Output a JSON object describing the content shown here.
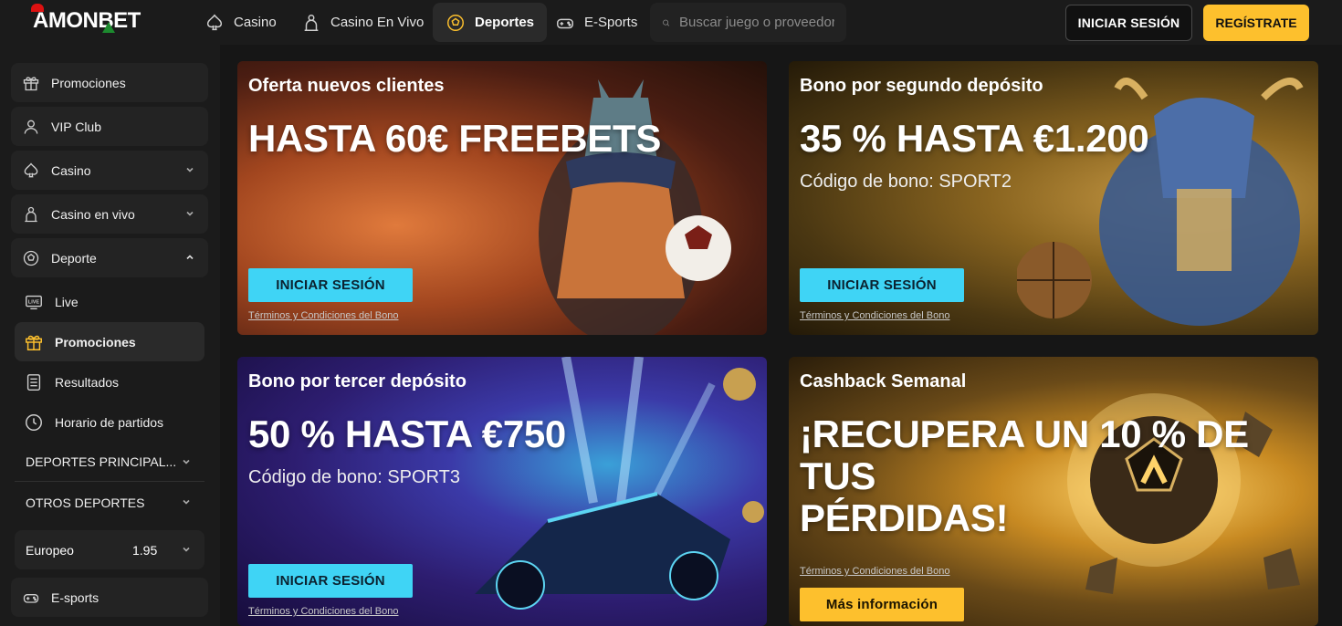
{
  "brand": {
    "logo_text": "AMONBET"
  },
  "topnav": {
    "items": [
      {
        "label": "Casino",
        "icon": "spade-icon"
      },
      {
        "label": "Casino En Vivo",
        "icon": "dealer-icon"
      },
      {
        "label": "Deportes",
        "icon": "soccer-ball-icon",
        "active": true
      },
      {
        "label": "E-Sports",
        "icon": "gamepad-icon"
      }
    ],
    "search_placeholder": "Buscar juego o proveedor",
    "login_label": "INICIAR SESIÓN",
    "register_label": "REGÍSTRATE"
  },
  "sidebar": {
    "items": [
      {
        "label": "Promociones",
        "icon": "gift-icon"
      },
      {
        "label": "VIP Club",
        "icon": "user-icon"
      },
      {
        "label": "Casino",
        "icon": "spade-icon"
      },
      {
        "label": "Casino en vivo",
        "icon": "dealer-icon"
      },
      {
        "label": "Deporte",
        "icon": "soccer-ball-icon"
      }
    ],
    "sub_items": [
      {
        "label": "Live",
        "icon": "live-icon"
      },
      {
        "label": "Promociones",
        "icon": "gift-icon",
        "active": true
      },
      {
        "label": "Resultados",
        "icon": "clipboard-icon"
      },
      {
        "label": "Horario de partidos",
        "icon": "clock-icon"
      }
    ],
    "categories": [
      "DEPORTES PRINCIPAL...",
      "OTROS DEPORTES"
    ],
    "odds_format": {
      "label": "Europeo",
      "value": "1.95"
    },
    "esports": {
      "label": "E-sports",
      "icon": "gamepad-icon"
    }
  },
  "promos": [
    {
      "kicker": "Oferta nuevos clientes",
      "headline": "HASTA 60€ FREEBETS",
      "code": "",
      "cta": "INICIAR SESIÓN",
      "terms": "Términos y Condiciones del Bono"
    },
    {
      "kicker": "Bono por segundo depósito",
      "headline": "35 % HASTA €1.200",
      "code": "Código de bono: SPORT2",
      "cta": "INICIAR SESIÓN",
      "terms": "Términos y Condiciones del Bono"
    },
    {
      "kicker": "Bono por tercer depósito",
      "headline": "50 % HASTA €750",
      "code": "Código de bono: SPORT3",
      "cta": "INICIAR SESIÓN",
      "terms": "Términos y Condiciones del Bono"
    },
    {
      "kicker": "Cashback Semanal",
      "headline_line1": "¡RECUPERA UN 10 % DE TUS",
      "headline_line2": "PÉRDIDAS!",
      "cta": "Más información",
      "terms": "Términos y Condiciones del Bono"
    }
  ],
  "colors": {
    "accent_yellow": "#fdc02d",
    "cta_cyan": "#3fd4f5",
    "bg": "#161616"
  }
}
